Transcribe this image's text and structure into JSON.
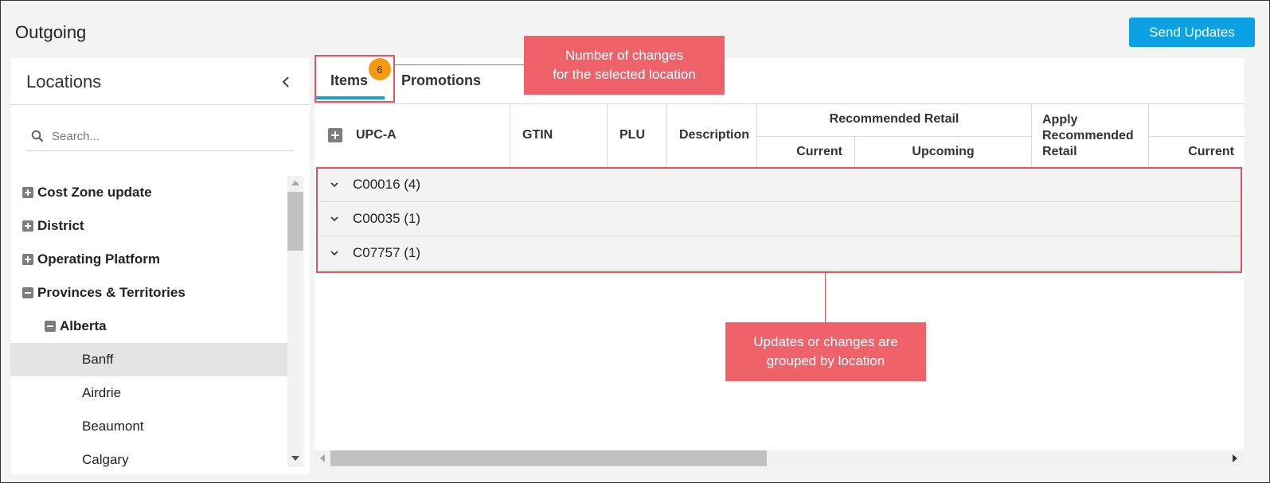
{
  "header": {
    "title": "Outgoing",
    "send_button": "Send Updates"
  },
  "locations_panel": {
    "title": "Locations",
    "search_placeholder": "Search...",
    "tree": [
      {
        "label": "Cost Zone update",
        "expander": "plus",
        "level": 0
      },
      {
        "label": "District",
        "expander": "plus",
        "level": 0
      },
      {
        "label": "Operating Platform",
        "expander": "plus",
        "level": 0
      },
      {
        "label": "Provinces & Territories",
        "expander": "minus",
        "level": 0
      },
      {
        "label": "Alberta",
        "expander": "minus",
        "level": 1
      },
      {
        "label": "Banff",
        "expander": "none",
        "level": 2,
        "selected": true
      },
      {
        "label": "Airdrie",
        "expander": "none",
        "level": 2
      },
      {
        "label": "Beaumont",
        "expander": "none",
        "level": 2
      },
      {
        "label": "Calgary",
        "expander": "none",
        "level": 2
      }
    ]
  },
  "tabs": [
    {
      "label": "Items",
      "badge": "6",
      "active": true
    },
    {
      "label": "Promotions",
      "active": false
    }
  ],
  "grid": {
    "columns": {
      "upca": "UPC-A",
      "gtin": "GTIN",
      "plu": "PLU",
      "description": "Description",
      "recommended_retail": "Recommended Retail",
      "rr_current": "Current",
      "rr_upcoming": "Upcoming",
      "apply_recommended_retail": "Apply Recommended Retail",
      "current": "Current"
    },
    "groups": [
      {
        "label": "C00016 (4)"
      },
      {
        "label": "C00035 (1)"
      },
      {
        "label": "C07757 (1)"
      }
    ]
  },
  "annotations": {
    "badge_callout_line1": "Number of changes",
    "badge_callout_line2": "for the selected location",
    "group_callout_line1": "Updates or changes are",
    "group_callout_line2": "grouped by location",
    "color": "#f0626a"
  },
  "colors": {
    "accent": "#0ba1e2",
    "badge": "#f59a0f",
    "tab_underline": "#18a0cf"
  }
}
